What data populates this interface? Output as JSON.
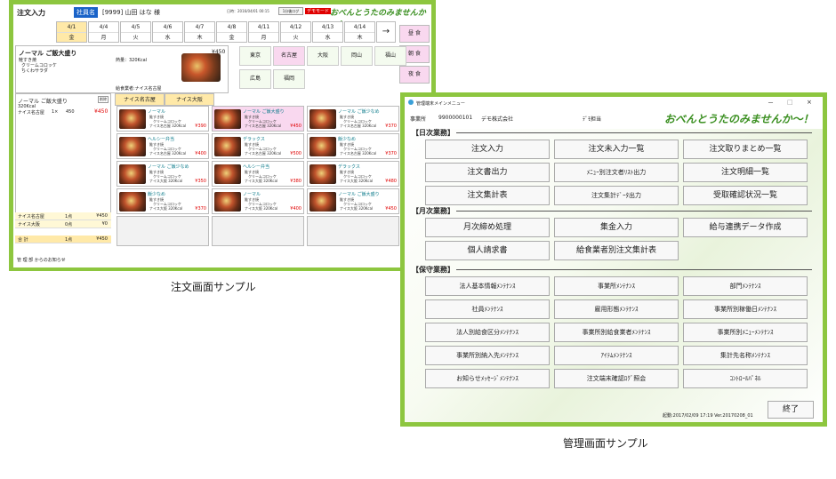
{
  "order": {
    "title": "注文入力",
    "employee_badge": "社員名",
    "employee_name": "[9999] 山田 はな 様",
    "date_info": "日時：2016/04/01 00:15",
    "small_btn": "1分後ログ",
    "demo_label": "デモモード",
    "slogan": "おべんとうたのみませんか～！",
    "dates": [
      {
        "d": "4/1",
        "w": "金"
      },
      {
        "d": "4/4",
        "w": "月"
      },
      {
        "d": "4/5",
        "w": "火"
      },
      {
        "d": "4/6",
        "w": "水"
      },
      {
        "d": "4/7",
        "w": "木"
      },
      {
        "d": "4/8",
        "w": "金"
      },
      {
        "d": "4/11",
        "w": "月"
      },
      {
        "d": "4/12",
        "w": "火"
      },
      {
        "d": "4/13",
        "w": "水"
      },
      {
        "d": "4/14",
        "w": "木"
      }
    ],
    "next_arrow": "→",
    "meals": [
      "昼 食",
      "朝 食",
      "夜 食"
    ],
    "item": {
      "name": "ノーマル ご飯大盛り",
      "price": "¥450",
      "desc1": "鮭すき焼",
      "desc2": "クリームコロッケ",
      "desc3": "ちくわサラダ",
      "calorie": "熱量：320Kcal",
      "supplier": "給食業者:ナイス名古屋"
    },
    "cities": [
      "東京",
      "名古屋",
      "大阪",
      "岡山",
      "福山",
      "広島",
      "福岡"
    ],
    "cart": {
      "name": "ノーマル ご飯大盛り",
      "delete": "削除",
      "kcal": "320Kcal",
      "supplier": "ナイス名古屋",
      "qty": "1×",
      "unit": "450",
      "price": "¥450"
    },
    "tabs": [
      "ナイス名古屋",
      "ナイス大阪"
    ],
    "grid": [
      {
        "name": "ノーマル",
        "s1": "鮭すき焼",
        "s2": "クリームコロッケ",
        "s3": "ナイス名古屋 320Kcal",
        "price": "¥390"
      },
      {
        "name": "ノーマル ご飯大盛り",
        "s1": "鮭すき焼",
        "s2": "クリームコロッケ",
        "s3": "ナイス名古屋 320Kcal",
        "price": "¥450"
      },
      {
        "name": "ノーマル ご飯少なめ",
        "s1": "鮭すき焼",
        "s2": "クリームコロッケ",
        "s3": "ナイス名古屋 320Kcal",
        "price": "¥370"
      },
      {
        "name": "ヘルシー弁当",
        "s1": "鮭すき焼",
        "s2": "クリームコロッケ",
        "s3": "ナイス名古屋 320Kcal",
        "price": "¥400"
      },
      {
        "name": "デラックス",
        "s1": "鮭すき焼",
        "s2": "クリームコロッケ",
        "s3": "ナイス名古屋 320Kcal",
        "price": "¥500"
      },
      {
        "name": "飯少なめ",
        "s1": "鮭すき焼",
        "s2": "クリームコロッケ",
        "s3": "ナイス名古屋 320Kcal",
        "price": "¥370"
      },
      {
        "name": "ノーマル ご飯少なめ",
        "s1": "鮭すき焼",
        "s2": "クリームコロッケ",
        "s3": "ナイス大阪 320Kcal",
        "price": "¥350"
      },
      {
        "name": "ヘルシー弁当",
        "s1": "鮭すき焼",
        "s2": "クリームコロッケ",
        "s3": "ナイス大阪 320Kcal",
        "price": "¥380"
      },
      {
        "name": "デラックス",
        "s1": "鮭すき焼",
        "s2": "クリームコロッケ",
        "s3": "ナイス大阪 320Kcal",
        "price": "¥480"
      },
      {
        "name": "飯少なめ",
        "s1": "鮭すき焼",
        "s2": "クリームコロッケ",
        "s3": "ナイス大阪 320Kcal",
        "price": "¥370"
      },
      {
        "name": "ノーマル",
        "s1": "鮭すき焼",
        "s2": "クリームコロッケ",
        "s3": "ナイス大阪 320Kcal",
        "price": "¥400"
      },
      {
        "name": "ノーマル ご飯大盛り",
        "s1": "鮭すき焼",
        "s2": "クリームコロッケ",
        "s3": "ナイス大阪 320Kcal",
        "price": "¥450"
      }
    ],
    "summary": [
      {
        "label": "ナイス名古屋",
        "count": "1点",
        "amount": "¥450"
      },
      {
        "label": "ナイス大阪",
        "count": "0点",
        "amount": "¥0"
      },
      {
        "label": "合 計",
        "count": "1点",
        "amount": "¥450"
      }
    ],
    "news": "管 理 部 からのお知らせ",
    "caption": "注文画面サンプル"
  },
  "admin": {
    "window_title": "管理端末メインメニュー",
    "window_controls": [
      "－",
      "□",
      "×"
    ],
    "office_label": "事業所",
    "office_code": "9900000101",
    "company": "デモ株式会社",
    "user": "ﾃﾞﾓ担当",
    "slogan": "おべんとうたのみませんか～！",
    "sections": [
      {
        "title": "【日次業務】",
        "buttons": [
          "注文入力",
          "注文未入力一覧",
          "注文取りまとめ一覧",
          "注文書出力",
          "ﾒﾆｭｰ別注文者ﾘｽﾄ出力",
          "注文明細一覧",
          "注文集計表",
          "注文集計ﾃﾞｰﾀ出力",
          "受取確認状況一覧"
        ]
      },
      {
        "title": "【月次業務】",
        "buttons": [
          "月次締め処理",
          "集金入力",
          "給与連携データ作成",
          "個人請求書",
          "給食業者別注文集計表"
        ]
      },
      {
        "title": "【保守業務】",
        "buttons": [
          "法人基本情報ﾒﾝﾃﾅﾝｽ",
          "事業所ﾒﾝﾃﾅﾝｽ",
          "部門ﾒﾝﾃﾅﾝｽ",
          "社員ﾒﾝﾃﾅﾝｽ",
          "雇用形態ﾒﾝﾃﾅﾝｽ",
          "事業所別稼働日ﾒﾝﾃﾅﾝｽ",
          "法人別給食区分ﾒﾝﾃﾅﾝｽ",
          "事業所別給食業者ﾒﾝﾃﾅﾝｽ",
          "事業所別ﾒﾆｭｰﾒﾝﾃﾅﾝｽ",
          "事業所別納入先ﾒﾝﾃﾅﾝｽ",
          "ｱｲﾃﾑﾒﾝﾃﾅﾝｽ",
          "集計先名称ﾒﾝﾃﾅﾝｽ",
          "お知らせﾒｯｾｰｼﾞﾒﾝﾃﾅﾝｽ",
          "注文端末確認ﾛｸﾞ照会",
          "ｺﾝﾄﾛｰﾙﾊﾟﾈﾙ"
        ]
      }
    ],
    "status": "起動:2017/02/09 17:19  Ver.20170208_01",
    "exit": "終了",
    "caption": "管理画面サンプル"
  },
  "colors": {
    "frame": "#8dc63f",
    "accent_pink": "#f9d8ef",
    "accent_yellow": "#ffe9a8",
    "price_red": "#e00000",
    "brand_green": "#3a8f20"
  }
}
